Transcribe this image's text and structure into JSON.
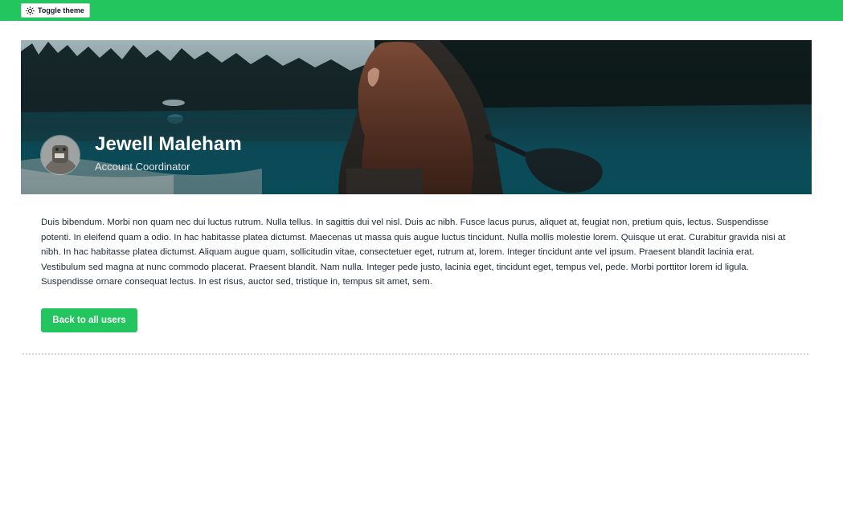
{
  "topbar": {
    "toggle_label": "Toggle theme",
    "toggle_icon": "sun-icon",
    "bg_color": "#22c55e"
  },
  "profile": {
    "name": "Jewell Maleham",
    "role": "Account Coordinator",
    "bio": "Duis bibendum. Morbi non quam nec dui luctus rutrum. Nulla tellus. In sagittis dui vel nisl. Duis ac nibh. Fusce lacus purus, aliquet at, feugiat non, pretium quis, lectus. Suspendisse potenti. In eleifend quam a odio. In hac habitasse platea dictumst. Maecenas ut massa quis augue luctus tincidunt. Nulla mollis molestie lorem. Quisque ut erat. Curabitur gravida nisi at nibh. In hac habitasse platea dictumst. Aliquam augue quam, sollicitudin vitae, consectetuer eget, rutrum at, lorem. Integer tincidunt ante vel ipsum. Praesent blandit lacinia erat. Vestibulum sed magna at nunc commodo placerat. Praesent blandit. Nam nulla. Integer pede justo, lacinia eget, tincidunt eget, tempus vel, pede. Morbi porttitor lorem id ligula. Suspendisse ornare consequat lectus. In est risus, auctor sed, tristique in, tempus sit amet, sem.",
    "back_label": "Back to all users"
  },
  "colors": {
    "accent": "#22c55e",
    "banner_water": "#0e5e6f",
    "banner_dark": "#101d1c"
  }
}
